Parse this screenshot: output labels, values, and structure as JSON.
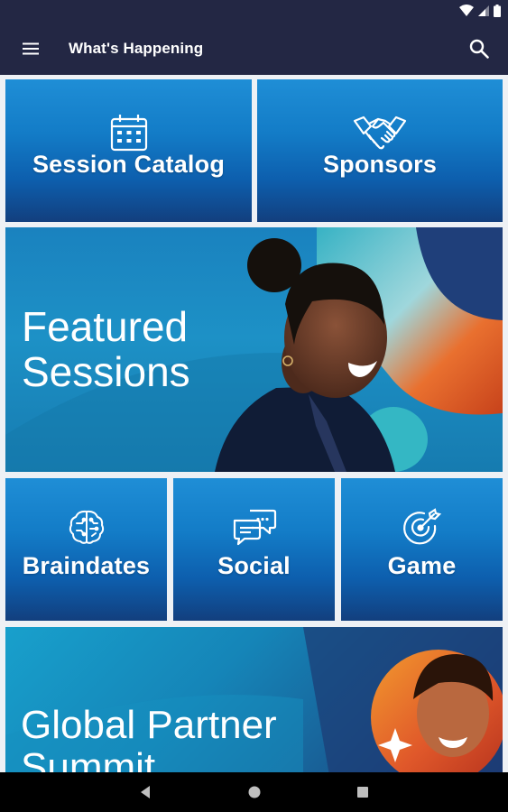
{
  "app": {
    "title": "What's Happening",
    "accent_header": "#232744",
    "tile_gradient": [
      "#1f8ed6",
      "#123f7e"
    ]
  },
  "status_bar": {
    "icons": [
      "wifi-icon",
      "signal-icon",
      "battery-icon"
    ]
  },
  "top_tiles": [
    {
      "label": "Session Catalog",
      "icon": "calendar-icon"
    },
    {
      "label": "Sponsors",
      "icon": "handshake-icon"
    }
  ],
  "featured": {
    "title_line1": "Featured",
    "title_line2": "Sessions"
  },
  "mid_tiles": [
    {
      "label": "Braindates",
      "icon": "brain-icon"
    },
    {
      "label": "Social",
      "icon": "chat-bubbles-icon"
    },
    {
      "label": "Game",
      "icon": "target-icon"
    }
  ],
  "partner": {
    "title_line1": "Global Partner",
    "title_line2": "Summit"
  },
  "nav_bar": {
    "buttons": [
      "back-icon",
      "home-icon",
      "recents-icon"
    ]
  }
}
